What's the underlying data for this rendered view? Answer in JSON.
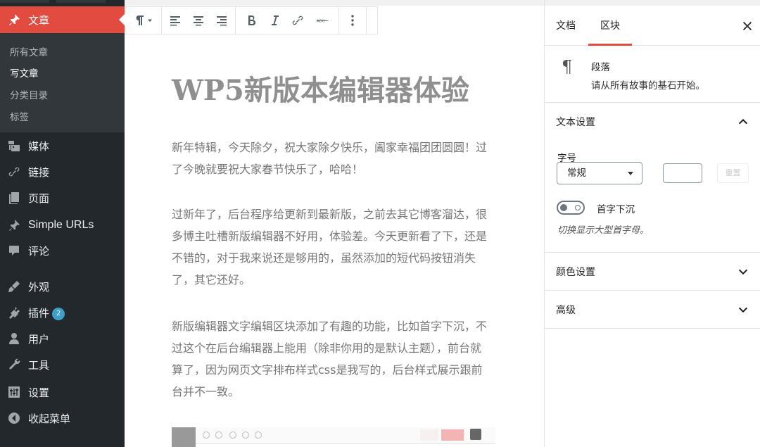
{
  "admin_menu": {
    "current": {
      "label": "文章",
      "icon": "pushpin-icon"
    },
    "submenu": [
      "所有文章",
      "写文章",
      "分类目录",
      "标签"
    ],
    "submenu_current_index": 1,
    "items": [
      {
        "label": "媒体",
        "icon": "media-icon"
      },
      {
        "label": "链接",
        "icon": "link-icon"
      },
      {
        "label": "页面",
        "icon": "pages-icon"
      },
      {
        "label": "Simple URLs",
        "icon": "pushpin-icon"
      },
      {
        "label": "评论",
        "icon": "comment-icon"
      },
      {
        "label": "外观",
        "icon": "brush-icon"
      },
      {
        "label": "插件",
        "icon": "plugin-icon",
        "badge": "2"
      },
      {
        "label": "用户",
        "icon": "user-icon"
      },
      {
        "label": "工具",
        "icon": "wrench-icon"
      },
      {
        "label": "设置",
        "icon": "settings-icon"
      },
      {
        "label": "收起菜单",
        "icon": "collapse-icon"
      }
    ],
    "colors": {
      "background": "#23282d",
      "submenu_bg": "#32373c",
      "accent": "#e24b40",
      "badge": "#3ca0c8"
    }
  },
  "toolbar": {
    "buttons": [
      "paragraph-icon",
      "chevron-down-icon",
      "align-left-icon",
      "align-center-icon",
      "align-right-icon",
      "bold-icon",
      "italic-icon",
      "link-icon",
      "strikethrough-icon",
      "more-options-icon"
    ]
  },
  "post": {
    "title_latin": "WP5",
    "title_cjk": "新版本编辑器体验",
    "paragraphs": [
      "新年特辑，今天除夕，祝大家除夕快乐，阖家幸福团团圆圆！过了今晚就要祝大家春节快乐了，哈哈！",
      "过新年了，后台程序给更新到最新版，之前去其它博客溜达，很多博主吐槽新版编辑器不好用，体验差。今天更新看了下，还是不错的，对于我来说还是够用的，虽然添加的短代码按钮消失了，其它还好。",
      "新版编辑器文字编辑区块添加了有趣的功能，比如首字下沉，不过这个在后台编辑器上能用（除非你用的是默认主题），前台就算了，因为网页文字排布样式css是我写的，后台样式展示跟前台并不一致。"
    ]
  },
  "sidebar": {
    "tabs": [
      "文档",
      "区块"
    ],
    "active_tab": "区块",
    "block": {
      "name": "段落",
      "description": "请从所有故事的基石开始。"
    },
    "text_settings": {
      "title": "文本设置",
      "font_size_label": "字号",
      "font_size_value": "常规",
      "custom_size_value": "",
      "reset_label": "重置",
      "drop_cap_label": "首字下沉",
      "drop_cap_enabled": false,
      "drop_cap_help": "切换显示大型首字母。"
    },
    "color_settings_title": "颜色设置",
    "advanced_title": "高级"
  }
}
